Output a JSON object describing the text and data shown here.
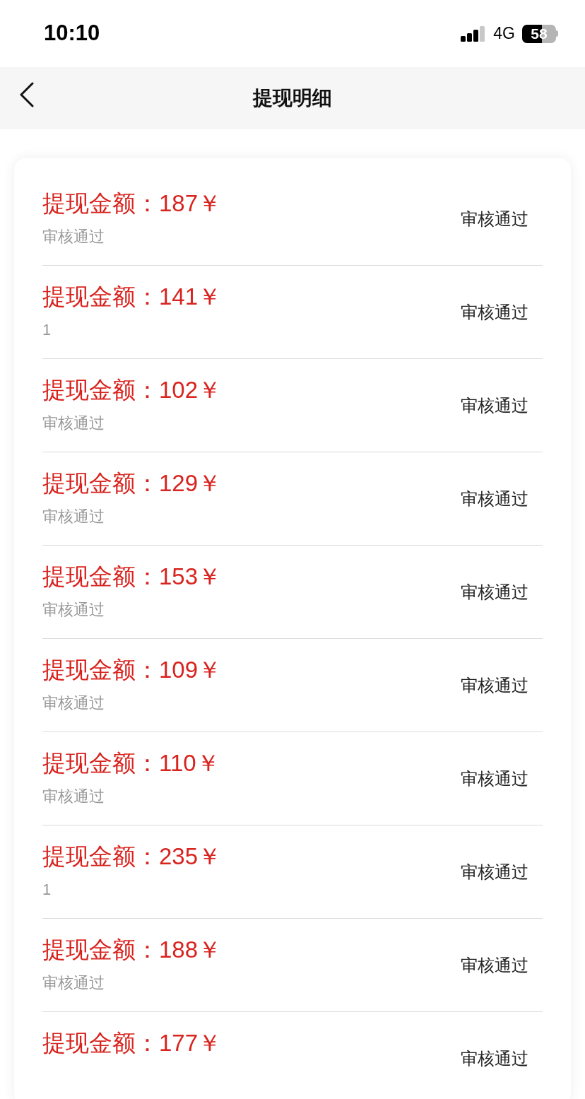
{
  "status_bar": {
    "time": "10:10",
    "network": "4G",
    "battery": "58"
  },
  "nav": {
    "title": "提现明细"
  },
  "records": [
    {
      "amount": "提现金额：187￥",
      "note": "审核通过",
      "status": "审核通过"
    },
    {
      "amount": "提现金额：141￥",
      "note": "1",
      "status": "审核通过"
    },
    {
      "amount": "提现金额：102￥",
      "note": "审核通过",
      "status": "审核通过"
    },
    {
      "amount": "提现金额：129￥",
      "note": "审核通过",
      "status": "审核通过"
    },
    {
      "amount": "提现金额：153￥",
      "note": "审核通过",
      "status": "审核通过"
    },
    {
      "amount": "提现金额：109￥",
      "note": "审核通过",
      "status": "审核通过"
    },
    {
      "amount": "提现金额：110￥",
      "note": "审核通过",
      "status": "审核通过"
    },
    {
      "amount": "提现金额：235￥",
      "note": "1",
      "status": "审核通过"
    },
    {
      "amount": "提现金额：188￥",
      "note": "审核通过",
      "status": "审核通过"
    },
    {
      "amount": "提现金额：177￥",
      "status": "审核通过"
    }
  ]
}
